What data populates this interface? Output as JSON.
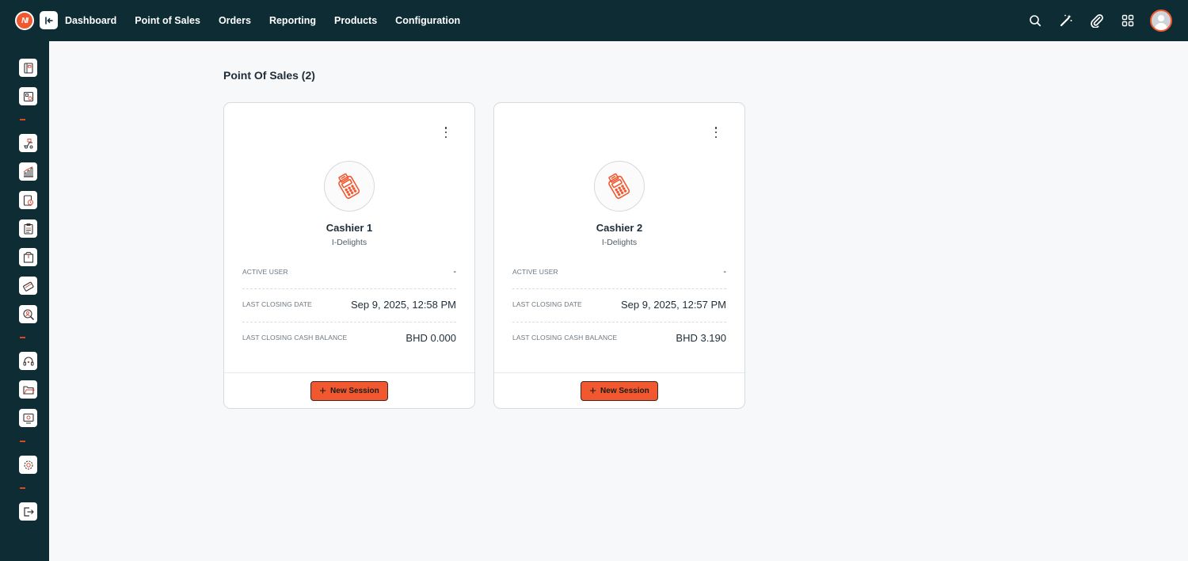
{
  "app": {
    "logo_text": "NI"
  },
  "nav": {
    "items": [
      {
        "label": "Dashboard"
      },
      {
        "label": "Point of Sales"
      },
      {
        "label": "Orders"
      },
      {
        "label": "Reporting"
      },
      {
        "label": "Products"
      },
      {
        "label": "Configuration"
      }
    ]
  },
  "topbar_icons": [
    "search-icon",
    "magic-wand-icon",
    "paperclip-icon",
    "apps-grid-icon",
    "user-avatar"
  ],
  "sidebar_icons": [
    "book-icon",
    "catalog-icon",
    "delivery-icon",
    "chart-icon",
    "clock-icon",
    "clipboard-icon",
    "package-icon",
    "payment-card-icon",
    "search-user-icon",
    "support-icon",
    "folder-icon",
    "monitor-icon",
    "settings-icon",
    "logout-icon"
  ],
  "main": {
    "title": "Point Of Sales (2)"
  },
  "cards": [
    {
      "name": "Cashier 1",
      "company": "I-Delights",
      "active_user_label": "ACTIVE USER",
      "active_user": "-",
      "last_closing_date_label": "LAST CLOSING DATE",
      "last_closing_date": "Sep 9, 2025, 12:58 PM",
      "cash_balance_label": "LAST CLOSING CASH BALANCE",
      "cash_balance": "BHD 0.000",
      "button_label": "New Session"
    },
    {
      "name": "Cashier 2",
      "company": "I-Delights",
      "active_user_label": "ACTIVE USER",
      "active_user": "-",
      "last_closing_date_label": "LAST CLOSING DATE",
      "last_closing_date": "Sep 9, 2025, 12:57 PM",
      "cash_balance_label": "LAST CLOSING CASH BALANCE",
      "cash_balance": "BHD 3.190",
      "button_label": "New Session"
    }
  ],
  "colors": {
    "topbar_bg": "#0d2c34",
    "accent": "#f1582f",
    "page_bg": "#f7f8fa"
  }
}
